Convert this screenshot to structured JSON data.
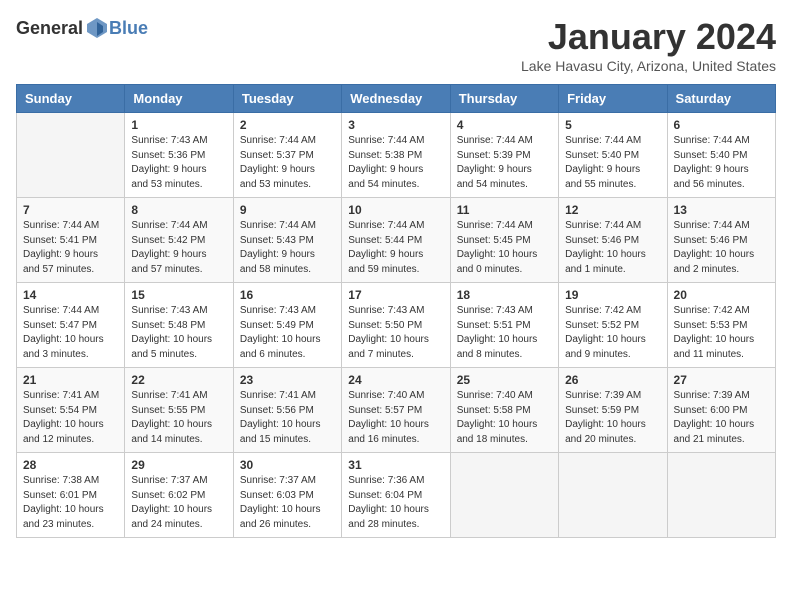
{
  "header": {
    "logo_general": "General",
    "logo_blue": "Blue",
    "month": "January 2024",
    "location": "Lake Havasu City, Arizona, United States"
  },
  "days_of_week": [
    "Sunday",
    "Monday",
    "Tuesday",
    "Wednesday",
    "Thursday",
    "Friday",
    "Saturday"
  ],
  "weeks": [
    [
      {
        "day": "",
        "info": ""
      },
      {
        "day": "1",
        "info": "Sunrise: 7:43 AM\nSunset: 5:36 PM\nDaylight: 9 hours\nand 53 minutes."
      },
      {
        "day": "2",
        "info": "Sunrise: 7:44 AM\nSunset: 5:37 PM\nDaylight: 9 hours\nand 53 minutes."
      },
      {
        "day": "3",
        "info": "Sunrise: 7:44 AM\nSunset: 5:38 PM\nDaylight: 9 hours\nand 54 minutes."
      },
      {
        "day": "4",
        "info": "Sunrise: 7:44 AM\nSunset: 5:39 PM\nDaylight: 9 hours\nand 54 minutes."
      },
      {
        "day": "5",
        "info": "Sunrise: 7:44 AM\nSunset: 5:40 PM\nDaylight: 9 hours\nand 55 minutes."
      },
      {
        "day": "6",
        "info": "Sunrise: 7:44 AM\nSunset: 5:40 PM\nDaylight: 9 hours\nand 56 minutes."
      }
    ],
    [
      {
        "day": "7",
        "info": "Sunrise: 7:44 AM\nSunset: 5:41 PM\nDaylight: 9 hours\nand 57 minutes."
      },
      {
        "day": "8",
        "info": "Sunrise: 7:44 AM\nSunset: 5:42 PM\nDaylight: 9 hours\nand 57 minutes."
      },
      {
        "day": "9",
        "info": "Sunrise: 7:44 AM\nSunset: 5:43 PM\nDaylight: 9 hours\nand 58 minutes."
      },
      {
        "day": "10",
        "info": "Sunrise: 7:44 AM\nSunset: 5:44 PM\nDaylight: 9 hours\nand 59 minutes."
      },
      {
        "day": "11",
        "info": "Sunrise: 7:44 AM\nSunset: 5:45 PM\nDaylight: 10 hours\nand 0 minutes."
      },
      {
        "day": "12",
        "info": "Sunrise: 7:44 AM\nSunset: 5:46 PM\nDaylight: 10 hours\nand 1 minute."
      },
      {
        "day": "13",
        "info": "Sunrise: 7:44 AM\nSunset: 5:46 PM\nDaylight: 10 hours\nand 2 minutes."
      }
    ],
    [
      {
        "day": "14",
        "info": "Sunrise: 7:44 AM\nSunset: 5:47 PM\nDaylight: 10 hours\nand 3 minutes."
      },
      {
        "day": "15",
        "info": "Sunrise: 7:43 AM\nSunset: 5:48 PM\nDaylight: 10 hours\nand 5 minutes."
      },
      {
        "day": "16",
        "info": "Sunrise: 7:43 AM\nSunset: 5:49 PM\nDaylight: 10 hours\nand 6 minutes."
      },
      {
        "day": "17",
        "info": "Sunrise: 7:43 AM\nSunset: 5:50 PM\nDaylight: 10 hours\nand 7 minutes."
      },
      {
        "day": "18",
        "info": "Sunrise: 7:43 AM\nSunset: 5:51 PM\nDaylight: 10 hours\nand 8 minutes."
      },
      {
        "day": "19",
        "info": "Sunrise: 7:42 AM\nSunset: 5:52 PM\nDaylight: 10 hours\nand 9 minutes."
      },
      {
        "day": "20",
        "info": "Sunrise: 7:42 AM\nSunset: 5:53 PM\nDaylight: 10 hours\nand 11 minutes."
      }
    ],
    [
      {
        "day": "21",
        "info": "Sunrise: 7:41 AM\nSunset: 5:54 PM\nDaylight: 10 hours\nand 12 minutes."
      },
      {
        "day": "22",
        "info": "Sunrise: 7:41 AM\nSunset: 5:55 PM\nDaylight: 10 hours\nand 14 minutes."
      },
      {
        "day": "23",
        "info": "Sunrise: 7:41 AM\nSunset: 5:56 PM\nDaylight: 10 hours\nand 15 minutes."
      },
      {
        "day": "24",
        "info": "Sunrise: 7:40 AM\nSunset: 5:57 PM\nDaylight: 10 hours\nand 16 minutes."
      },
      {
        "day": "25",
        "info": "Sunrise: 7:40 AM\nSunset: 5:58 PM\nDaylight: 10 hours\nand 18 minutes."
      },
      {
        "day": "26",
        "info": "Sunrise: 7:39 AM\nSunset: 5:59 PM\nDaylight: 10 hours\nand 20 minutes."
      },
      {
        "day": "27",
        "info": "Sunrise: 7:39 AM\nSunset: 6:00 PM\nDaylight: 10 hours\nand 21 minutes."
      }
    ],
    [
      {
        "day": "28",
        "info": "Sunrise: 7:38 AM\nSunset: 6:01 PM\nDaylight: 10 hours\nand 23 minutes."
      },
      {
        "day": "29",
        "info": "Sunrise: 7:37 AM\nSunset: 6:02 PM\nDaylight: 10 hours\nand 24 minutes."
      },
      {
        "day": "30",
        "info": "Sunrise: 7:37 AM\nSunset: 6:03 PM\nDaylight: 10 hours\nand 26 minutes."
      },
      {
        "day": "31",
        "info": "Sunrise: 7:36 AM\nSunset: 6:04 PM\nDaylight: 10 hours\nand 28 minutes."
      },
      {
        "day": "",
        "info": ""
      },
      {
        "day": "",
        "info": ""
      },
      {
        "day": "",
        "info": ""
      }
    ]
  ]
}
